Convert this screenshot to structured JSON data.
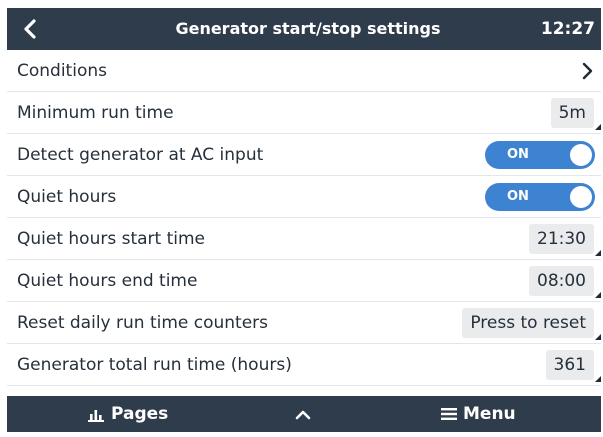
{
  "header": {
    "title": "Generator start/stop settings",
    "time": "12:27"
  },
  "rows": [
    {
      "label": "Conditions"
    },
    {
      "label": "Minimum run time",
      "value": "5m"
    },
    {
      "label": "Detect generator at AC input",
      "toggle": "ON"
    },
    {
      "label": "Quiet hours",
      "toggle": "ON"
    },
    {
      "label": "Quiet hours start time",
      "value": "21:30"
    },
    {
      "label": "Quiet hours end time",
      "value": "08:00"
    },
    {
      "label": "Reset daily run time counters",
      "value": "Press to reset"
    },
    {
      "label": "Generator total run time (hours)",
      "value": "361"
    }
  ],
  "footer": {
    "pages_label": "Pages",
    "menu_label": "Menu"
  },
  "colors": {
    "bar": "#2f3c4c",
    "toggle_on": "#3d83d1",
    "value_bg": "#e9ebed"
  },
  "icons": [
    "back-chevron-icon",
    "chevron-right-icon",
    "chart-icon",
    "chevron-up-icon",
    "hamburger-icon"
  ]
}
